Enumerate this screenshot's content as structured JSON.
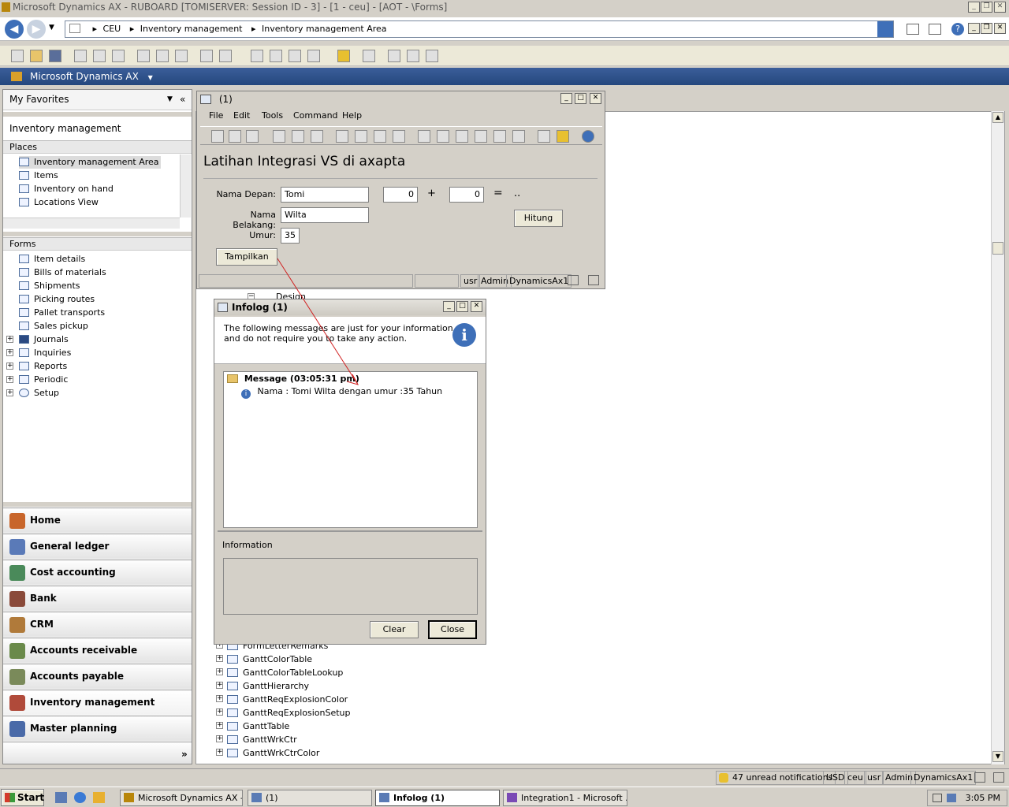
{
  "window": {
    "title": "Microsoft Dynamics AX - RUBOARD [TOMISERVER: Session ID - 3] - [1 - ceu] - [AOT - \\Forms]"
  },
  "breadcrumb": {
    "items": [
      "CEU",
      "Inventory management",
      "Inventory management Area"
    ]
  },
  "appbar": {
    "title": "Microsoft Dynamics AX"
  },
  "nav": {
    "favorites": "My Favorites",
    "area": "Inventory management",
    "places_title": "Places",
    "places": [
      "Inventory management Area",
      "Items",
      "Inventory on hand",
      "Locations View"
    ],
    "forms_title": "Forms",
    "forms": [
      "Item details",
      "Bills of materials",
      "Shipments",
      "Picking routes",
      "Pallet transports",
      "Sales pickup"
    ],
    "folders": [
      "Journals",
      "Inquiries",
      "Reports",
      "Periodic",
      "Setup"
    ],
    "modules": [
      "Home",
      "General ledger",
      "Cost accounting",
      "Bank",
      "CRM",
      "Accounts receivable",
      "Accounts payable",
      "Inventory management",
      "Master planning"
    ]
  },
  "aot": {
    "design": "Design",
    "rows": [
      "FormLetterRemarks",
      "GanttColorTable",
      "GanttColorTableLookup",
      "GanttHierarchy",
      "GanttReqExplosionColor",
      "GanttReqExplosionSetup",
      "GanttTable",
      "GanttWrkCtr",
      "GanttWrkCtrColor"
    ]
  },
  "form": {
    "title": "(1)",
    "menu": [
      "File",
      "Edit",
      "Tools",
      "Command",
      "Help"
    ],
    "heading": "Latihan Integrasi VS di axapta",
    "nama_depan_label": "Nama Depan:",
    "nama_depan": "Tomi",
    "nama_belakang_label": "Nama Belakang:",
    "nama_belakang": "Wilta",
    "umur_label": "Umur:",
    "umur": "35",
    "num1": "0",
    "plus": "+",
    "num2": "0",
    "equals": "=",
    "result": "..",
    "hitung": "Hitung",
    "tampilkan": "Tampilkan",
    "status": [
      "usr",
      "Admin",
      "DynamicsAx1"
    ]
  },
  "infolog": {
    "title": "Infolog (1)",
    "message": "The following messages are just for your information and do not require you to take any action.",
    "tree_header": "Message (03:05:31 pm)",
    "tree_item": "Nama : Tomi Wilta dengan umur :35 Tahun",
    "info_label": "Information",
    "clear": "Clear",
    "close": "Close"
  },
  "statusbar": [
    "47 unread notifications",
    "USD",
    "ceu",
    "usr",
    "Admin",
    "DynamicsAx1"
  ],
  "taskbar": {
    "start": "Start",
    "tasks": [
      "Microsoft Dynamics AX - ...",
      "(1)",
      "Infolog (1)",
      "Integration1 - Microsoft ..."
    ],
    "clock": "3:05 PM"
  },
  "colors": {
    "accent": "#24477d",
    "arrow": "#d02020"
  }
}
